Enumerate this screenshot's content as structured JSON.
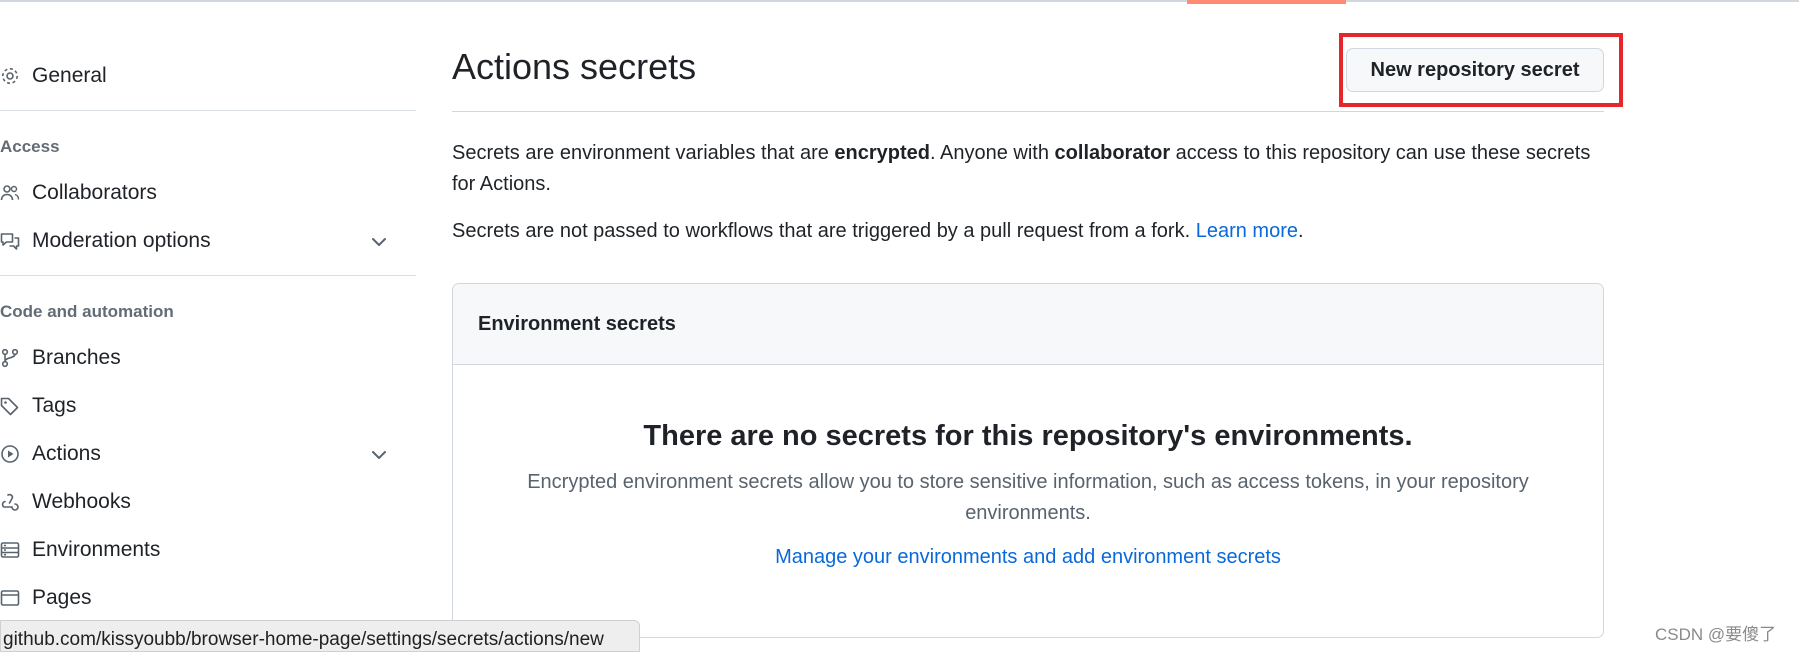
{
  "sidebar": {
    "items": [
      {
        "label": "General",
        "icon": "gear-icon"
      },
      {
        "label": "Collaborators",
        "icon": "people-icon"
      },
      {
        "label": "Moderation options",
        "icon": "comment-discussion-icon",
        "expandable": true
      },
      {
        "label": "Branches",
        "icon": "git-branch-icon"
      },
      {
        "label": "Tags",
        "icon": "tag-icon"
      },
      {
        "label": "Actions",
        "icon": "play-icon",
        "expandable": true
      },
      {
        "label": "Webhooks",
        "icon": "webhook-icon"
      },
      {
        "label": "Environments",
        "icon": "server-icon"
      },
      {
        "label": "Pages",
        "icon": "browser-icon"
      }
    ],
    "sections": {
      "access": "Access",
      "code_automation": "Code and automation"
    }
  },
  "main": {
    "title": "Actions secrets",
    "new_secret_button": "New repository secret",
    "description": {
      "part1": "Secrets are environment variables that are ",
      "bold1": "encrypted",
      "part2": ". Anyone with ",
      "bold2": "collaborator",
      "part3": " access to this repository can use these secrets for Actions."
    },
    "fork_note": {
      "text": "Secrets are not passed to workflows that are triggered by a pull request from a fork. ",
      "link": "Learn more",
      "suffix": "."
    },
    "environment_secrets": {
      "header": "Environment secrets",
      "blank_title": "There are no secrets for this repository's environments.",
      "blank_description": "Encrypted environment secrets allow you to store sensitive information, such as access tokens, in your repository environments.",
      "manage_link": "Manage your environments and add environment secrets"
    }
  },
  "status_bar": {
    "url": "github.com/kissyoubb/browser-home-page/settings/secrets/actions/new"
  },
  "watermark": "CSDN @要傻了",
  "colors": {
    "accent_link": "#0969da",
    "highlight_box": "#e5262b",
    "tab_underline": "#fd8c73"
  }
}
